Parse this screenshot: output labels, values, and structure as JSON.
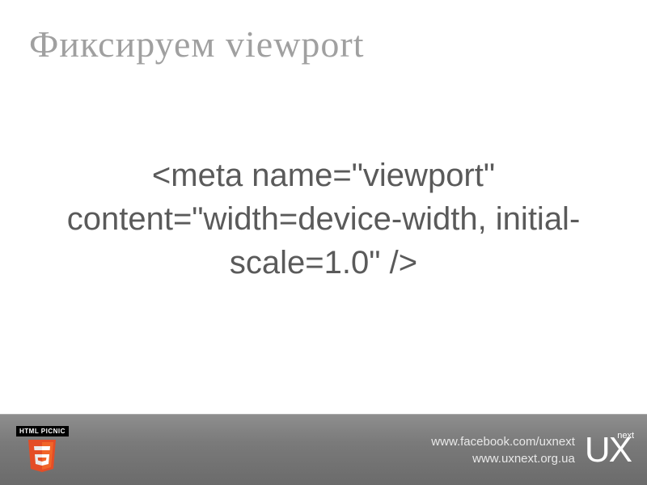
{
  "title": "Фиксируем viewport",
  "code": "<meta name=\"viewport\" content=\"width=device-width, initial-scale=1.0\" />",
  "footer": {
    "picnic_label": "HTML PICNIC",
    "link1": "www.facebook.com/uxnext",
    "link2": "www.uxnext.org.ua",
    "logo_main": "UX",
    "logo_sub": "next"
  }
}
